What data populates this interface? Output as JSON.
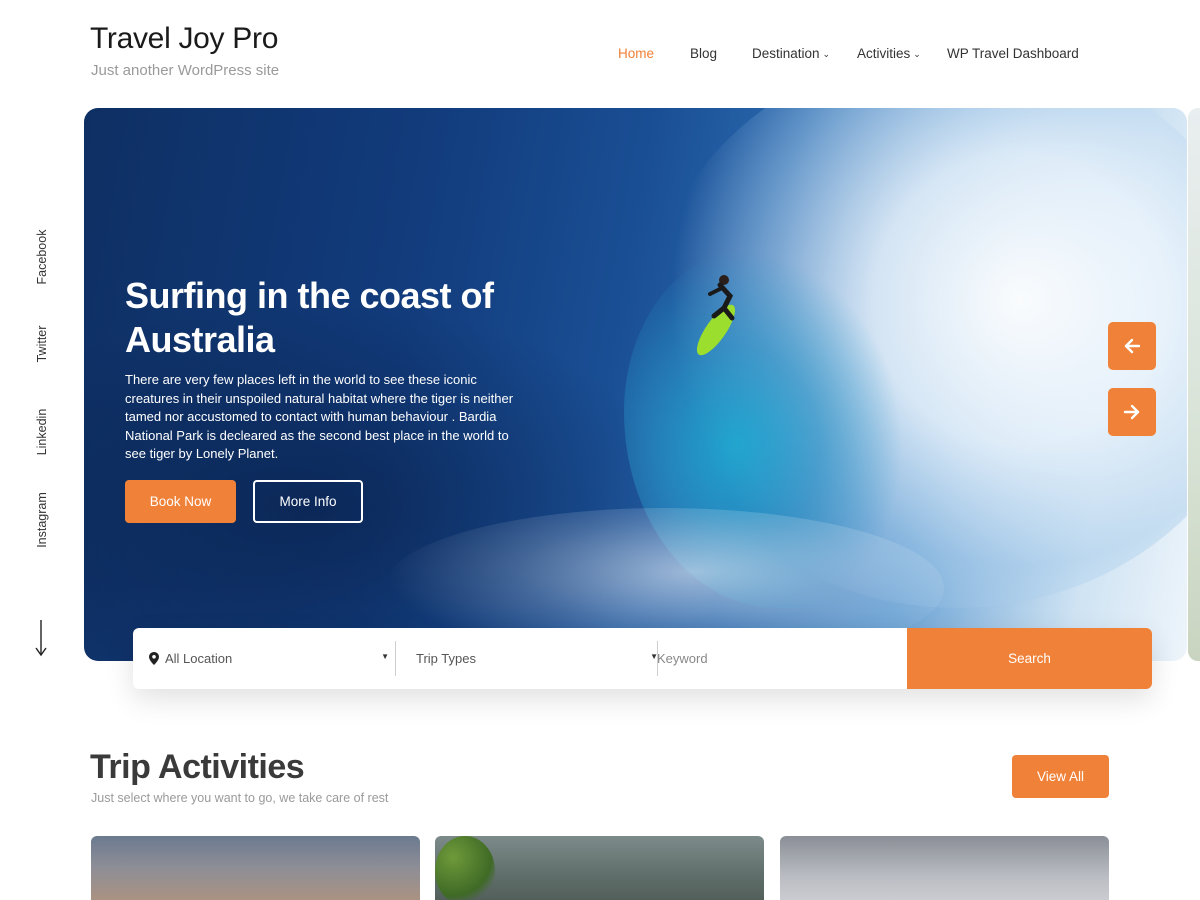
{
  "site": {
    "title": "Travel Joy Pro",
    "tagline": "Just another WordPress site"
  },
  "nav": {
    "items": [
      {
        "label": "Home",
        "active": true
      },
      {
        "label": "Blog"
      },
      {
        "label": "Destination",
        "has_submenu": true
      },
      {
        "label": "Activities",
        "has_submenu": true
      },
      {
        "label": "WP Travel Dashboard"
      }
    ],
    "submenu_icon": "chevron-down-icon"
  },
  "social": {
    "links": [
      "Facebook",
      "Twitter",
      "Linkedin",
      "Instagram"
    ],
    "scroll_icon": "arrow-down-icon"
  },
  "hero": {
    "title": "Surfing in the coast of Australia",
    "description": "There are very few places left in the world to see these iconic creatures in their unspoiled natural habitat where the tiger is neither tamed nor accustomed to contact with human behaviour . Bardia National Park is decleared as the second best place in the world to see tiger by Lonely Planet.",
    "primary_button": "Book Now",
    "secondary_button": "More Info",
    "prev_icon": "arrow-left-icon",
    "next_icon": "arrow-right-icon"
  },
  "search": {
    "location_value": "All Location",
    "location_icon": "map-pin-icon",
    "trip_types_value": "Trip Types",
    "keyword_placeholder": "Keyword",
    "button_label": "Search"
  },
  "activities": {
    "title": "Trip Activities",
    "subtitle": "Just select where you want to go, we take care of rest",
    "view_all": "View All"
  },
  "colors": {
    "accent": "#f08138",
    "text_dark": "#1a1a1a",
    "text_muted": "#9a9a9a"
  }
}
